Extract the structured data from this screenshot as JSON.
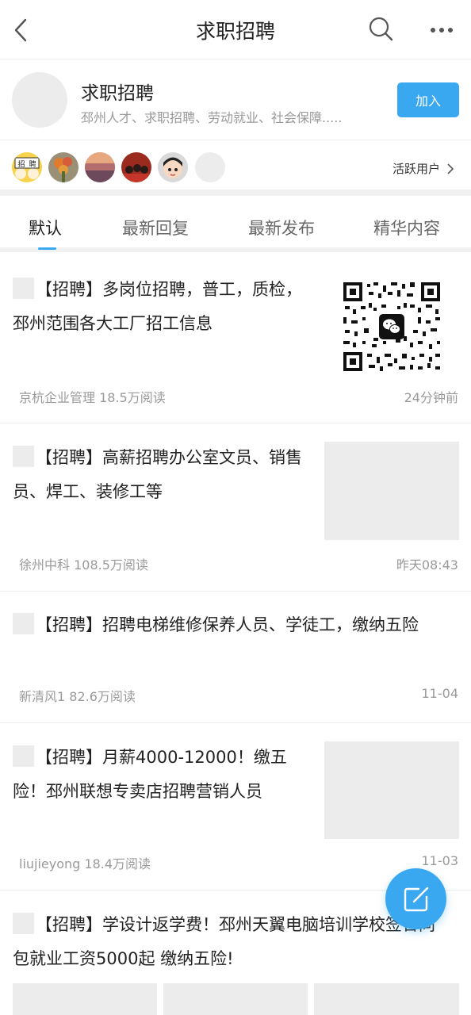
{
  "header": {
    "title": "求职招聘"
  },
  "group": {
    "name": "求职招聘",
    "description": "邳州人才、求职招聘、劳动就业、社会保障.....",
    "join_label": "加入"
  },
  "active_users": {
    "label": "活跃用户"
  },
  "tabs": [
    {
      "label": "默认",
      "active": true
    },
    {
      "label": "最新回复",
      "active": false
    },
    {
      "label": "最新发布",
      "active": false
    },
    {
      "label": "精华内容",
      "active": false
    }
  ],
  "posts": [
    {
      "title": "【招聘】多岗位招聘，普工，质检，邳州范围各大工厂招工信息",
      "author": "京杭企业管理",
      "reads": "18.5万阅读",
      "time": "24分钟前"
    },
    {
      "title": "【招聘】高薪招聘办公室文员、销售员、焊工、装修工等",
      "author": "徐州中科",
      "reads": "108.5万阅读",
      "time": "昨天08:43"
    },
    {
      "title": "【招聘】招聘电梯维修保养人员、学徒工，缴纳五险",
      "author": "新清风1",
      "reads": "82.6万阅读",
      "time": "11-04"
    },
    {
      "title": "【招聘】月薪4000-12000！缴五险！邳州联想专卖店招聘营销人员",
      "author": "liujieyong",
      "reads": "18.4万阅读",
      "time": "11-03"
    },
    {
      "title": "【招聘】学设计返学费！邳州天翼电脑培训学校签合同包就业工资5000起 缴纳五险!"
    }
  ],
  "recruit_badge": {
    "left": "招",
    "right": "聘"
  },
  "colors": {
    "accent": "#3aa8f0",
    "divider": "#ececec",
    "placeholder": "#ececec"
  },
  "icons": [
    "back-arrow-icon",
    "search-icon",
    "more-icon",
    "chevron-right-icon",
    "wechat-icon",
    "edit-icon"
  ]
}
